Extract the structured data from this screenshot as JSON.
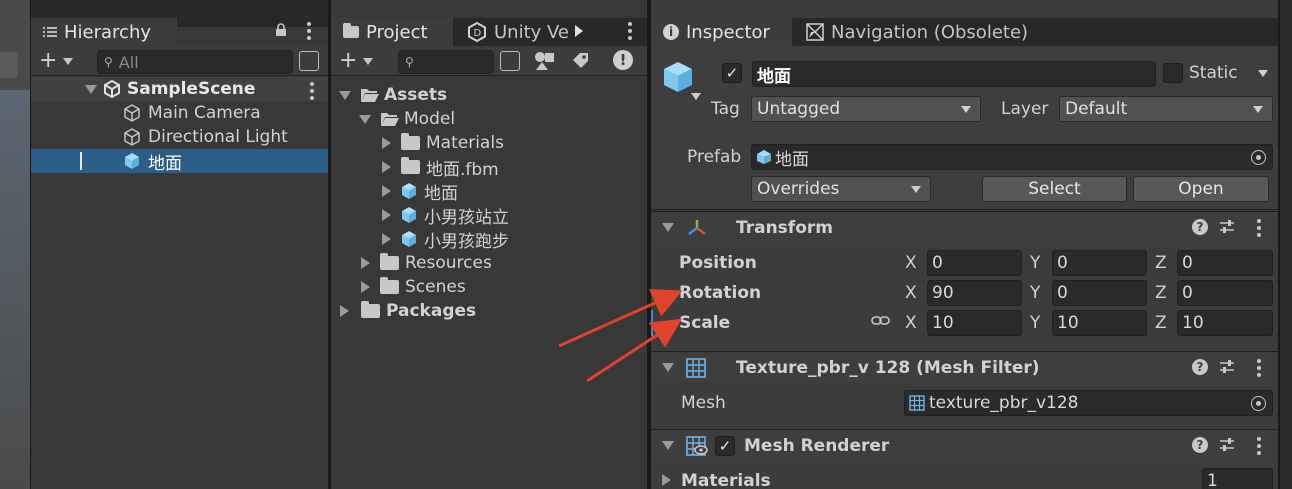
{
  "colors": {
    "panel_bg": "#383838",
    "selection": "#2c5d87",
    "annotation_arrow": "#e0432a",
    "cube_icon": "#7ec8f0"
  },
  "hierarchy": {
    "tab_label": "Hierarchy",
    "search_placeholder": "All",
    "items": [
      {
        "label": "SampleScene",
        "icon": "unity-scene-icon"
      },
      {
        "label": "Main Camera",
        "icon": "gameobject-icon"
      },
      {
        "label": "Directional Light",
        "icon": "gameobject-icon"
      },
      {
        "label": "地面",
        "icon": "prefab-icon",
        "selected": true
      }
    ]
  },
  "project": {
    "tabs": [
      {
        "label": "Project",
        "icon": "folder-icon"
      },
      {
        "label": "Unity Ve",
        "icon": "unity-version-control-icon"
      }
    ],
    "tree": [
      {
        "label": "Assets",
        "expanded": true
      },
      {
        "label": "Model",
        "expanded": true
      },
      {
        "label": "Materials"
      },
      {
        "label": "地面.fbm"
      },
      {
        "label": "地面"
      },
      {
        "label": "小男孩站立"
      },
      {
        "label": "小男孩跑步"
      },
      {
        "label": "Resources"
      },
      {
        "label": "Scenes"
      },
      {
        "label": "Packages"
      }
    ]
  },
  "inspector": {
    "tabs": [
      {
        "label": "Inspector",
        "icon": "info-icon"
      },
      {
        "label": "Navigation (Obsolete)",
        "icon": "navigation-icon"
      }
    ],
    "object_name": "地面",
    "static_label": "Static",
    "tag_label": "Tag",
    "tag_value": "Untagged",
    "layer_label": "Layer",
    "layer_value": "Default",
    "prefab_label": "Prefab",
    "prefab_value": "地面",
    "overrides_label": "Overrides",
    "select_label": "Select",
    "open_label": "Open",
    "transform": {
      "title": "Transform",
      "position_label": "Position",
      "rotation_label": "Rotation",
      "scale_label": "Scale",
      "axis_x": "X",
      "axis_y": "Y",
      "axis_z": "Z",
      "position": {
        "x": "0",
        "y": "0",
        "z": "0"
      },
      "rotation": {
        "x": "90",
        "y": "0",
        "z": "0"
      },
      "scale": {
        "x": "10",
        "y": "10",
        "z": "10"
      }
    },
    "mesh_filter": {
      "title": "Texture_pbr_v 128 (Mesh Filter)",
      "mesh_label": "Mesh",
      "mesh_value": "texture_pbr_v128"
    },
    "mesh_renderer": {
      "title": "Mesh Renderer",
      "materials_label": "Materials",
      "materials_count": "1"
    }
  }
}
